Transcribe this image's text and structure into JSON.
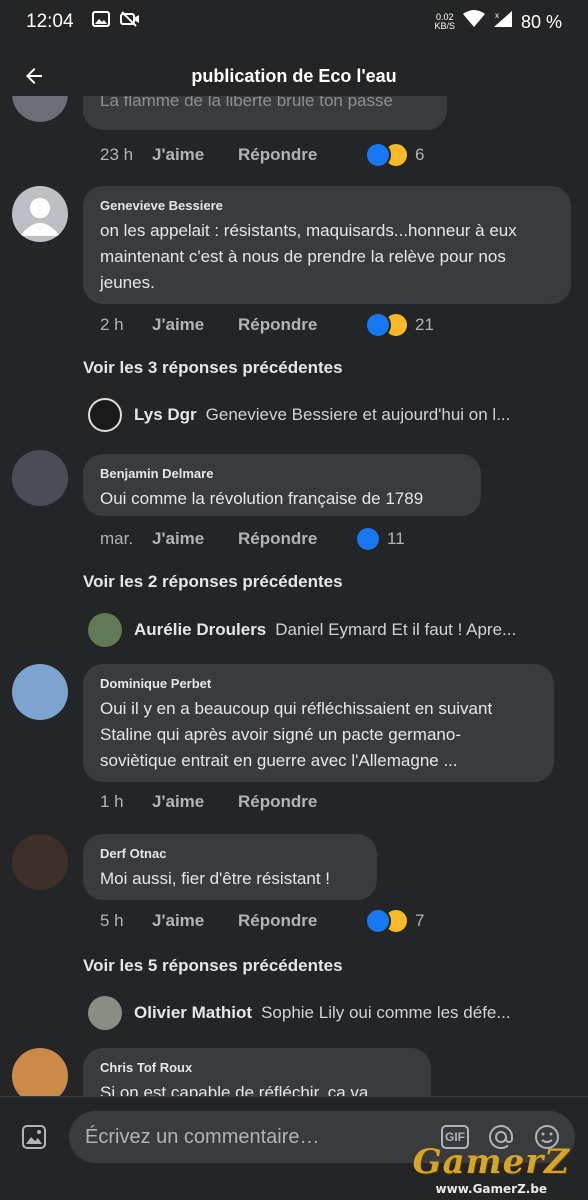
{
  "status": {
    "time": "12:04",
    "netspeed_value": "0.02",
    "netspeed_unit": "KB/S",
    "battery": "80 %"
  },
  "appbar": {
    "title": "publication de Eco l'eau"
  },
  "top_partial": {
    "text": "La flamme de la liberté brûle ton passé",
    "time": "23 h",
    "like_label": "J'aime",
    "reply_label": "Répondre",
    "reaction_count": "6"
  },
  "comments": [
    {
      "author": "Genevieve Bessiere",
      "text": "on les appelait : résistants, maquisards...honneur à eux maintenant c'est à nous de prendre la relève pour nos jeunes.",
      "time": "2 h",
      "like_label": "J'aime",
      "reply_label": "Répondre",
      "reaction_count": "21",
      "more_replies": "Voir les 3 réponses précédentes",
      "reply_name": "Lys Dgr",
      "reply_snippet": "Genevieve Bessiere et aujourd'hui  on l..."
    },
    {
      "author": "Benjamin Delmare",
      "text": "Oui comme la révolution française de 1789",
      "time": "mar.",
      "like_label": "J'aime",
      "reply_label": "Répondre",
      "reaction_count": "11",
      "more_replies": "Voir les 2 réponses précédentes",
      "reply_name": "Aurélie Droulers",
      "reply_snippet": "Daniel Eymard Et il faut ! Apre..."
    },
    {
      "author": "Dominique Perbet",
      "text": "Oui il y en a beaucoup qui réfléchissaient en suivant Staline qui après avoir signé un pacte germano-soviètique entrait en guerre avec l'Allemagne ...",
      "time": "1 h",
      "like_label": "J'aime",
      "reply_label": "Répondre"
    },
    {
      "author": "Derf Otnac",
      "text": "Moi aussi, fier d'être résistant !",
      "time": "5 h",
      "like_label": "J'aime",
      "reply_label": "Répondre",
      "reaction_count": "7",
      "more_replies": "Voir les 5 réponses précédentes",
      "reply_name": "Olivier Mathiot",
      "reply_snippet": "Sophie Lily oui comme les défe..."
    },
    {
      "author": "Chris Tof Roux",
      "text": "Si on est capable de réfléchir, ça va..."
    }
  ],
  "composer": {
    "placeholder": "Écrivez un commentaire…",
    "gif_label": "GIF"
  },
  "watermark": {
    "brand": "GamerZ",
    "url": "www.GamerZ.be"
  },
  "colors": {
    "background": "#242526",
    "bubble": "#3a3b3c",
    "like_blue": "#1877f2",
    "haha_yellow": "#f7b928"
  }
}
